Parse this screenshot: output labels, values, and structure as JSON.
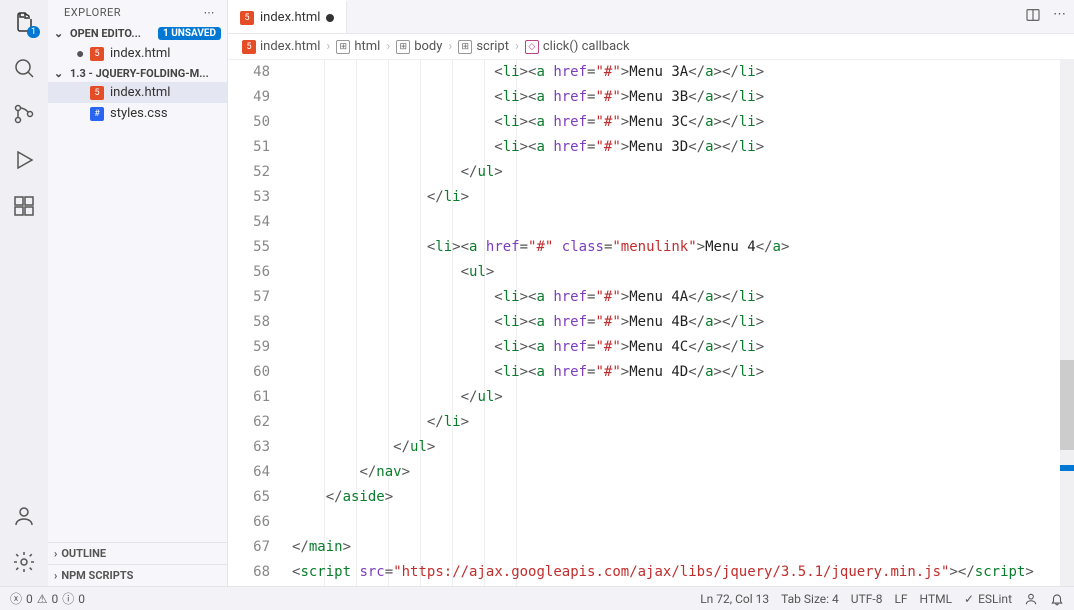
{
  "activity_badge": "1",
  "explorer": {
    "title": "EXPLORER",
    "sections": {
      "open_editors_label": "OPEN EDITO...",
      "unsaved_badge": "1 UNSAVED",
      "folder_label": "1.3 - JQUERY-FOLDING-M...",
      "outline_label": "OUTLINE",
      "npm_label": "NPM SCRIPTS"
    },
    "open_editors": [
      {
        "name": "index.html",
        "modified": true
      }
    ],
    "files": [
      {
        "name": "index.html",
        "type": "html",
        "selected": true
      },
      {
        "name": "styles.css",
        "type": "css",
        "selected": false
      }
    ]
  },
  "tabs": [
    {
      "name": "index.html",
      "modified": true
    }
  ],
  "breadcrumbs": [
    {
      "label": "index.html",
      "kind": "file"
    },
    {
      "label": "html",
      "kind": "sym"
    },
    {
      "label": "body",
      "kind": "sym"
    },
    {
      "label": "script",
      "kind": "sym"
    },
    {
      "label": "click() callback",
      "kind": "fn"
    }
  ],
  "code": {
    "first_line": 48,
    "lines": [
      {
        "indent": 24,
        "type": "li_a",
        "text": "Menu 3A"
      },
      {
        "indent": 24,
        "type": "li_a",
        "text": "Menu 3B"
      },
      {
        "indent": 24,
        "type": "li_a",
        "text": "Menu 3C"
      },
      {
        "indent": 24,
        "type": "li_a",
        "text": "Menu 3D"
      },
      {
        "indent": 20,
        "type": "close",
        "tag": "ul"
      },
      {
        "indent": 16,
        "type": "close",
        "tag": "li"
      },
      {
        "indent": 0,
        "type": "blank"
      },
      {
        "indent": 16,
        "type": "li_menulink",
        "text": "Menu 4"
      },
      {
        "indent": 20,
        "type": "open",
        "tag": "ul"
      },
      {
        "indent": 24,
        "type": "li_a",
        "text": "Menu 4A"
      },
      {
        "indent": 24,
        "type": "li_a",
        "text": "Menu 4B"
      },
      {
        "indent": 24,
        "type": "li_a",
        "text": "Menu 4C"
      },
      {
        "indent": 24,
        "type": "li_a",
        "text": "Menu 4D"
      },
      {
        "indent": 20,
        "type": "close",
        "tag": "ul"
      },
      {
        "indent": 16,
        "type": "close",
        "tag": "li"
      },
      {
        "indent": 12,
        "type": "close",
        "tag": "ul"
      },
      {
        "indent": 8,
        "type": "close",
        "tag": "nav"
      },
      {
        "indent": 4,
        "type": "close",
        "tag": "aside"
      },
      {
        "indent": 0,
        "type": "blank"
      },
      {
        "indent": 0,
        "type": "close",
        "tag": "main"
      },
      {
        "indent": 0,
        "type": "script_src",
        "src": "https://ajax.googleapis.com/ajax/libs/jquery/3.5.1/jquery.min.js"
      }
    ]
  },
  "status": {
    "errors": "0",
    "warnings": "0",
    "infos": "0",
    "cursor": "Ln 72, Col 13",
    "tab_size": "Tab Size: 4",
    "encoding": "UTF-8",
    "eol": "LF",
    "language": "HTML",
    "eslint": "ESLint"
  }
}
